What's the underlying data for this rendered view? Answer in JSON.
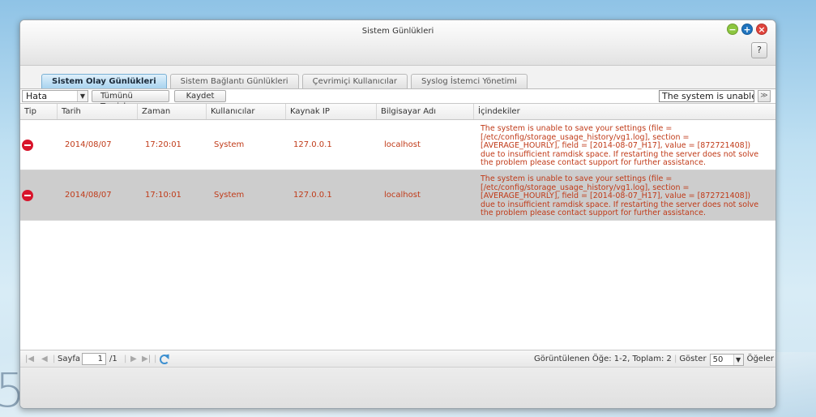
{
  "window": {
    "title": "Sistem Günlükleri",
    "help_label": "?"
  },
  "tabs": [
    {
      "label": "Sistem Olay Günlükleri",
      "active": true
    },
    {
      "label": "Sistem Bağlantı Günlükleri",
      "active": false
    },
    {
      "label": "Çevrimiçi Kullanıcılar",
      "active": false
    },
    {
      "label": "Syslog İstemci Yönetimi",
      "active": false
    }
  ],
  "toolbar": {
    "level_value": "Hata",
    "clear_label": "Tümünü Temizle",
    "save_label": "Kaydet",
    "filter_value": "The system is unable t"
  },
  "columns": {
    "tip": "Tip",
    "date": "Tarih",
    "time": "Zaman",
    "user": "Kullanıcılar",
    "ip": "Kaynak IP",
    "host": "Bilgisayar Adı",
    "content": "İçindekiler"
  },
  "rows": [
    {
      "date": "2014/08/07",
      "time": "17:20:01",
      "user": "System",
      "ip": "127.0.0.1",
      "host": "localhost",
      "content": "The system is unable to save your settings (file = [/etc/config/storage_usage_history/vg1.log], section = [AVERAGE_HOURLY], field = [2014-08-07_H17], value = [872721408]) due to insufficient ramdisk space. If restarting the server does not solve the problem please contact support for further assistance.",
      "selected": false
    },
    {
      "date": "2014/08/07",
      "time": "17:10:01",
      "user": "System",
      "ip": "127.0.0.1",
      "host": "localhost",
      "content": "The system is unable to save your settings (file = [/etc/config/storage_usage_history/vg1.log], section = [AVERAGE_HOURLY], field = [2014-08-07_H17], value = [872721408]) due to insufficient ramdisk space. If restarting the server does not solve the problem please contact support for further assistance.",
      "selected": true
    }
  ],
  "pager": {
    "page_label": "Sayfa",
    "page_value": "1",
    "total_pages": "/1",
    "summary": "Görüntülenen Öğe: 1-2, Toplam: 2",
    "show_label": "Göster",
    "page_size": "50",
    "items_label": "Öğeler"
  },
  "colors": {
    "error_text": "#c03a18",
    "active_tab": "#a8d3ef",
    "selected_row": "#cdcdcd"
  }
}
